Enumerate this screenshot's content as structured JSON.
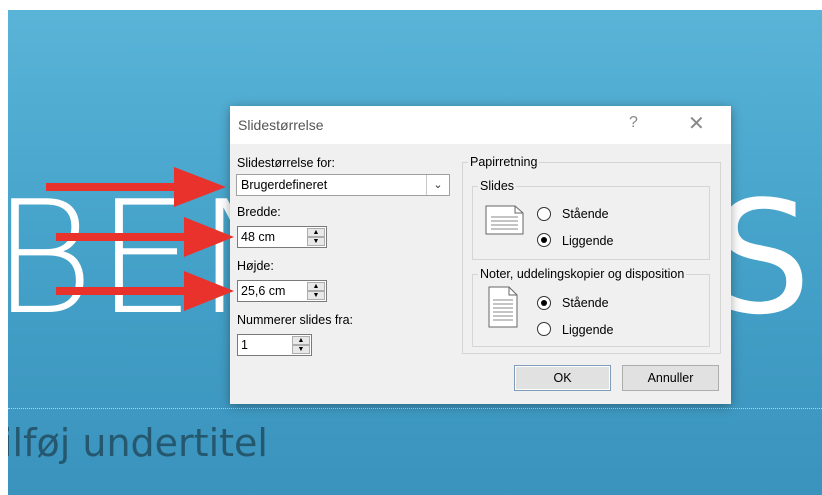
{
  "slide": {
    "title_left": "BEN",
    "title_right": "S!",
    "subtitle": "ilføj undertitel"
  },
  "dialog": {
    "title": "Slidestørrelse",
    "help": "?",
    "close": "✕",
    "size_for_label": "Slidestørrelse for:",
    "size_for_value": "Brugerdefineret",
    "width_label": "Bredde:",
    "width_value": "48 cm",
    "height_label": "Højde:",
    "height_value": "25,6 cm",
    "number_from_label": "Nummerer slides fra:",
    "number_from_value": "1",
    "orientation_label": "Papirretning",
    "slides_group_label": "Slides",
    "slides_portrait": "Stående",
    "slides_landscape": "Liggende",
    "slides_selected": "Liggende",
    "notes_group_label": "Noter, uddelingskopier og disposition",
    "notes_portrait": "Stående",
    "notes_landscape": "Liggende",
    "notes_selected": "Stående",
    "ok": "OK",
    "cancel": "Annuller"
  },
  "colors": {
    "slide_bg": "#4aa8cf",
    "arrow": "#e8322b",
    "dialog_bg": "#f0f0f0"
  }
}
